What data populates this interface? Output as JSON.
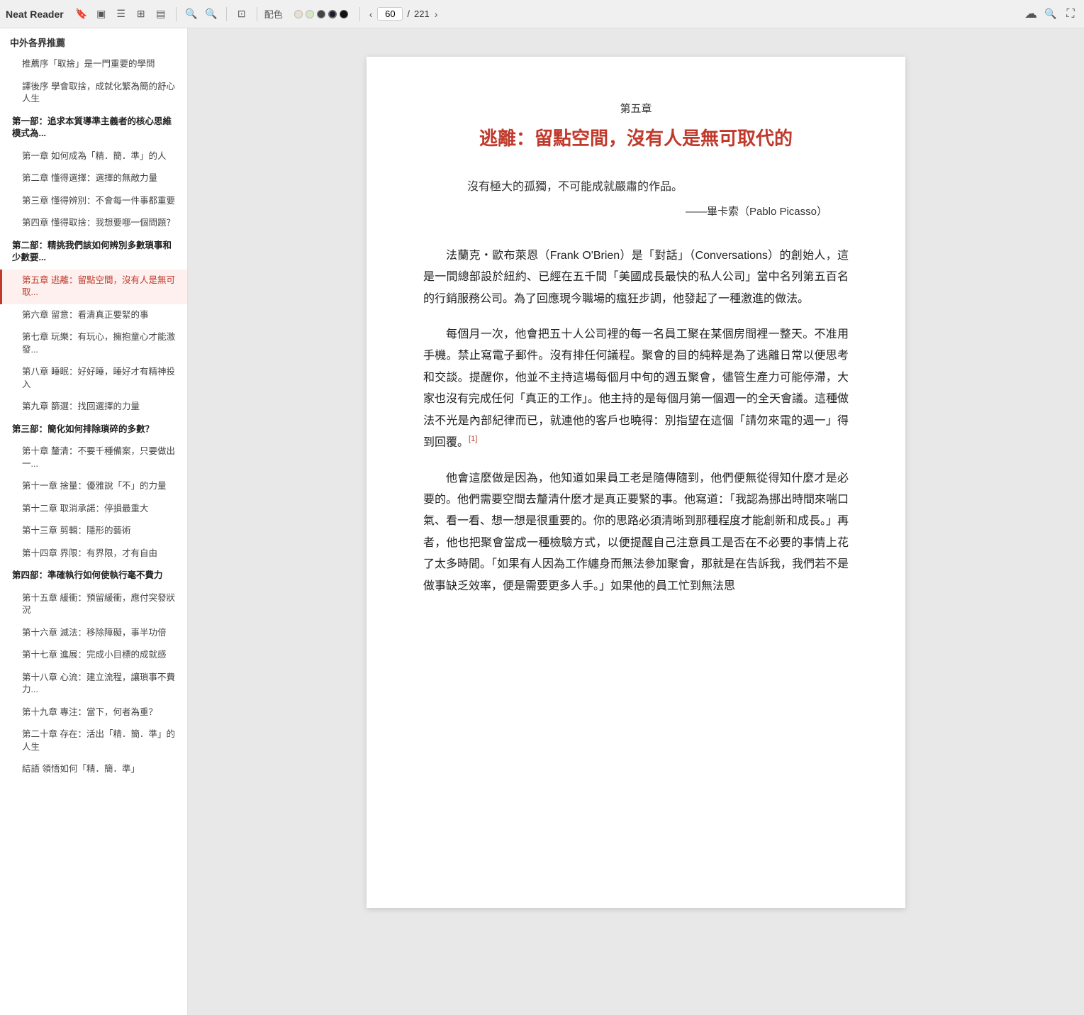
{
  "app": {
    "name": "Neat Reader"
  },
  "toolbar": {
    "icons": [
      {
        "name": "bookmark-icon",
        "glyph": "🔖"
      },
      {
        "name": "layout-book-icon",
        "glyph": "▣"
      },
      {
        "name": "menu-icon",
        "glyph": "☰"
      },
      {
        "name": "grid-icon",
        "glyph": "⊞"
      },
      {
        "name": "document-icon",
        "glyph": "▤"
      },
      {
        "name": "search-icon",
        "glyph": "🔍"
      },
      {
        "name": "search2-icon",
        "glyph": "🔍"
      },
      {
        "name": "fit-icon",
        "glyph": "⊡"
      }
    ],
    "color_label": "配色",
    "colors": [
      {
        "value": "#e8e0d0",
        "active": false
      },
      {
        "value": "#d4e8c2",
        "active": false
      },
      {
        "value": "#333333",
        "active": false
      },
      {
        "value": "#1a1a2e",
        "active": true
      },
      {
        "value": "#111111",
        "active": false
      }
    ],
    "page_current": "60",
    "page_total": "221",
    "cloud_icon": "☁",
    "search_icon": "🔍",
    "fullscreen_icon": "⛶"
  },
  "sidebar": {
    "header": "中外各界推薦",
    "items": [
      {
        "id": "rec1",
        "label": "推薦序「取捨」是一門重要的學問",
        "level": "top",
        "active": false
      },
      {
        "id": "rec2",
        "label": "譯後序 學會取捨，成就化繁為簡的舒心人生",
        "level": "top",
        "active": false
      },
      {
        "id": "part1",
        "label": "第一部：追求本質導準主義者的核心思維模式為...",
        "level": "section",
        "active": false
      },
      {
        "id": "ch1",
        "label": "第一章 如何成為「精．簡．準」的人",
        "level": "sub",
        "active": false
      },
      {
        "id": "ch2",
        "label": "第二章 懂得選擇：選擇的無敵力量",
        "level": "sub",
        "active": false
      },
      {
        "id": "ch3",
        "label": "第三章 懂得辨別：不會每一件事都重要",
        "level": "sub",
        "active": false
      },
      {
        "id": "ch4",
        "label": "第四章 懂得取捨：我想要哪一個問題？",
        "level": "sub",
        "active": false
      },
      {
        "id": "part2",
        "label": "第二部：精挑我們該如何辨別多數瑣事和少數要...",
        "level": "section",
        "active": false
      },
      {
        "id": "ch5",
        "label": "第五章 逃離：留點空間，沒有人是無可取...",
        "level": "sub",
        "active": true
      },
      {
        "id": "ch6",
        "label": "第六章 留意：看清真正要緊的事",
        "level": "sub",
        "active": false
      },
      {
        "id": "ch7",
        "label": "第七章 玩樂：有玩心，擁抱童心才能激發...",
        "level": "sub",
        "active": false
      },
      {
        "id": "ch8",
        "label": "第八章 睡眠：好好睡，睡好才有精神投入",
        "level": "sub",
        "active": false
      },
      {
        "id": "ch9",
        "label": "第九章 篩選：找回選擇的力量",
        "level": "sub",
        "active": false
      },
      {
        "id": "part3",
        "label": "第三部：簡化如何排除瑣碎的多數？",
        "level": "section",
        "active": false
      },
      {
        "id": "ch10",
        "label": "第十章 釐清：不要千種備案，只要做出一...",
        "level": "sub",
        "active": false
      },
      {
        "id": "ch11",
        "label": "第十一章 捨量：優雅說「不」的力量",
        "level": "sub",
        "active": false
      },
      {
        "id": "ch12",
        "label": "第十二章 取消承諾：停損最重大",
        "level": "sub",
        "active": false
      },
      {
        "id": "ch13",
        "label": "第十三章 剪輯：隱形的藝術",
        "level": "sub",
        "active": false
      },
      {
        "id": "ch14",
        "label": "第十四章 界限：有界限，才有自由",
        "level": "sub",
        "active": false
      },
      {
        "id": "part4",
        "label": "第四部：準確執行如何使執行毫不費力",
        "level": "section",
        "active": false
      },
      {
        "id": "ch15",
        "label": "第十五章 緩衝：預留緩衝，應付突發狀況",
        "level": "sub",
        "active": false
      },
      {
        "id": "ch16",
        "label": "第十六章 滅法：移除障礙，事半功倍",
        "level": "sub",
        "active": false
      },
      {
        "id": "ch17",
        "label": "第十七章 進展：完成小目標的成就感",
        "level": "sub",
        "active": false
      },
      {
        "id": "ch18",
        "label": "第十八章 心流：建立流程，讓瑣事不費力...",
        "level": "sub",
        "active": false
      },
      {
        "id": "ch19",
        "label": "第十九章 專注：當下，何者為重？",
        "level": "sub",
        "active": false
      },
      {
        "id": "ch20",
        "label": "第二十章 存在：活出「精．簡．準」的人生",
        "level": "sub",
        "active": false
      },
      {
        "id": "end",
        "label": "結語 領悟如何「精．簡．準」",
        "level": "sub",
        "active": false
      }
    ]
  },
  "page": {
    "chapter_label": "第五章",
    "chapter_title": "逃離：留點空間，沒有人是無可取代的",
    "quote_text": "沒有極大的孤獨，不可能成就嚴肅的作品。",
    "quote_attr": "——畢卡索（Pablo Picasso）",
    "paragraphs": [
      "法蘭克・歐布萊恩（Frank O'Brien）是「對話」（Conversations）的創始人，這是一間總部設於紐約、已經在五千間「美國成長最快的私人公司」當中名列第五百名的行銷服務公司。為了回應現今職場的瘋狂步調，他發起了一種激進的做法。",
      "每個月一次，他會把五十人公司裡的每一名員工聚在某個房間裡一整天。不准用手機。禁止寫電子郵件。沒有排任何議程。聚會的目的純粹是為了逃離日常以便思考和交談。提醒你，他並不主持這場每個月中旬的週五聚會，儘管生產力可能停滯，大家也沒有完成任何「真正的工作」。他主持的是每個月第一個週一的全天會議。這種做法不光是內部紀律而已，就連他的客戶也曉得：別指望在這個「請勿來電的週一」得到回覆。[1]",
      "他會這麼做是因為，他知道如果員工老是隨傳隨到，他們便無從得知什麼才是必要的。他們需要空間去釐清什麼才是真正要緊的事。他寫道：「我認為挪出時間來喘口氣、看一看、想一想是很重要的。你的思路必須清晰到那種程度才能創新和成長。」再者，他也把聚會當成一種檢驗方式，以便提醒自己注意員工是否在不必要的事情上花了太多時間。「如果有人因為工作纏身而無法參加聚會，那就是在告訴我，我們若不是做事缺乏效率，便是需要更多人手。」如果他的員工忙到無法思"
    ]
  }
}
